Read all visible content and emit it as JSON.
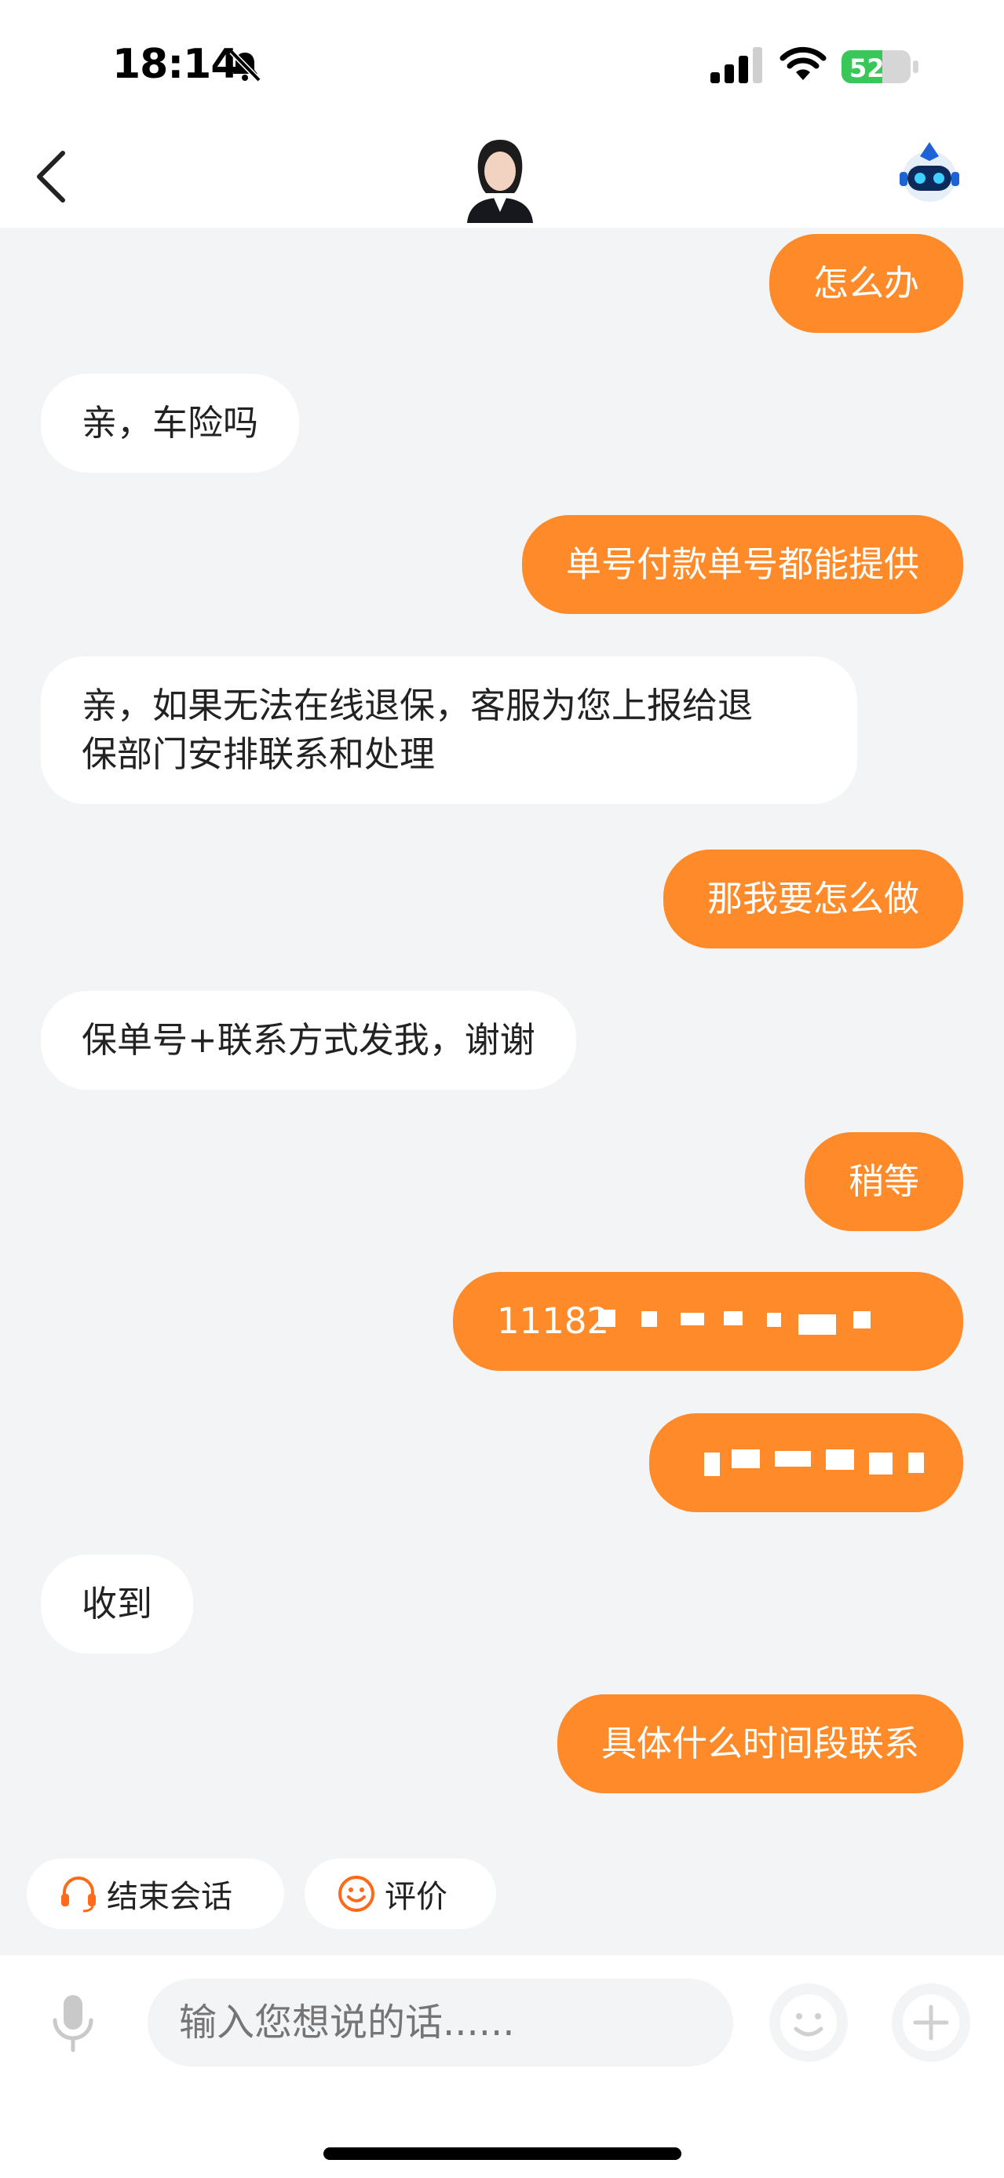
{
  "status_bar": {
    "time": "18:14",
    "battery": "52"
  },
  "header": {
    "back_icon": "chevron-left-icon",
    "avatar": "agent-avatar",
    "bot_icon": "robot-assistant-icon"
  },
  "messages": [
    {
      "side": "out",
      "text": "怎么办"
    },
    {
      "side": "in",
      "text": "亲，车险吗"
    },
    {
      "side": "out",
      "text": "单号付款单号都能提供"
    },
    {
      "side": "in",
      "lines": [
        "亲，如果无法在线退保，客服为您上报给退",
        "保部门安排联系和处理"
      ]
    },
    {
      "side": "out",
      "text": "那我要怎么做"
    },
    {
      "side": "in",
      "text": "保单号+联系方式发我，谢谢"
    },
    {
      "side": "out",
      "text": "稍等"
    },
    {
      "side": "out",
      "text": "11182"
    },
    {
      "side": "out",
      "text": ""
    },
    {
      "side": "in",
      "text": "收到"
    },
    {
      "side": "out",
      "text": "具体什么时间段联系"
    }
  ],
  "quick_actions": {
    "end_session": "结束会话",
    "rate": "评价"
  },
  "input": {
    "placeholder": "输入您想说的话......"
  },
  "colors": {
    "accent": "#ff8a2a",
    "background": "#f3f4f6",
    "bubble_in": "#ffffff"
  }
}
